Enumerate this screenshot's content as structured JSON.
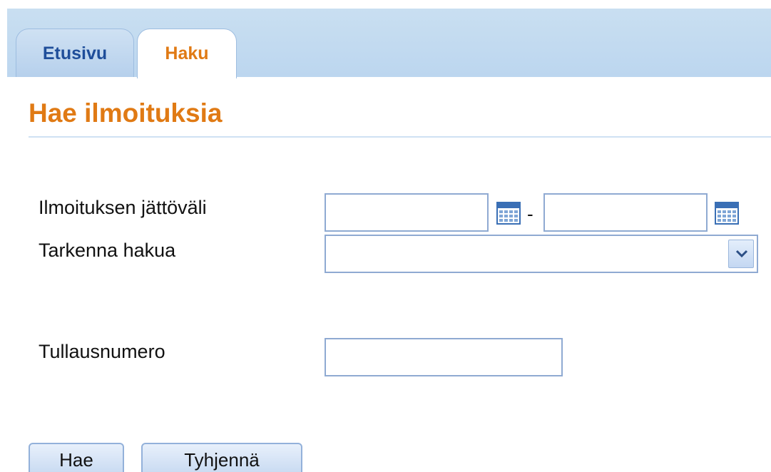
{
  "tabs": [
    {
      "label": "Etusivu",
      "active": false
    },
    {
      "label": "Haku",
      "active": true
    }
  ],
  "page_title": "Hae ilmoituksia",
  "form": {
    "period_label": "Ilmoituksen jättöväli",
    "period_from_value": "",
    "period_to_value": "",
    "period_separator": "-",
    "refine_label": "Tarkenna hakua",
    "refine_selected": "",
    "customs_label": "Tullausnumero",
    "customs_value": ""
  },
  "buttons": {
    "search": "Hae",
    "clear": "Tyhjennä"
  },
  "colors": {
    "accent_orange": "#e07a14",
    "tab_blue_text": "#1f4e9a",
    "header_bar": "#c9dff1",
    "input_border": "#8faad2"
  },
  "icons": [
    "calendar-icon",
    "chevron-down-icon"
  ]
}
